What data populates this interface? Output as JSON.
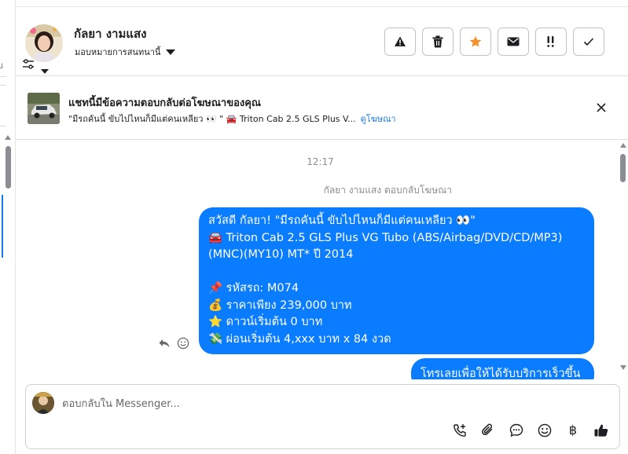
{
  "colors": {
    "accent": "#1877f2",
    "bubble": "#0a7cff",
    "star": "#f5922f",
    "border": "#bec3c9"
  },
  "header": {
    "name": "กัลยา งามแสง",
    "assign_label": "มอบหมายการสนทนานี้",
    "actions": [
      {
        "icon": "warning-icon",
        "glyph": "⚠"
      },
      {
        "icon": "trash-icon",
        "glyph": ""
      },
      {
        "icon": "star-icon",
        "glyph": "★"
      },
      {
        "icon": "mail-icon",
        "glyph": ""
      },
      {
        "icon": "follow-up-icon",
        "glyph": "!!"
      },
      {
        "icon": "checkmark-icon",
        "glyph": "✓"
      }
    ]
  },
  "left_strip": {
    "partial_char": "บ"
  },
  "banner": {
    "title": "แชทนี้มีข้อความตอบกลับต่อโฆษณาของคุณ",
    "subtitle": "\"มีรถคันนี้ ขับไปไหนก็มีแต่คนเหลียว 👀 \" 🚘 Triton Cab 2.5 GLS Plus V...",
    "link": "ดูโฆษณา"
  },
  "conversation": {
    "timestamp": "12:17",
    "reply_note": "กัลยา งามแสง ตอบกลับโฆษณา",
    "message_lines": [
      "สวัสดี กัลยา! \"มีรถคันนี้ ขับไปไหนก็มีแต่คนเหลียว 👀\"",
      "🚘 Triton Cab 2.5 GLS Plus VG Tubo (ABS/Airbag/DVD/CD/MP3)",
      "(MNC)(MY10) MT* ปี 2014",
      "",
      "📌 รหัสรถ: M074",
      "💰 ราคาเพียง 239,000 บาท",
      "⭐ ดาวน์เริ่มต้น 0 บาท",
      "💸 ผ่อนเริ่มต้น 4,xxx บาท x 84 งวด"
    ],
    "second_message": "โทรเลยเพื่อให้ได้รับบริการเร็วขึ้น"
  },
  "composer": {
    "placeholder": "ตอบกลับใน Messenger...",
    "tools": [
      {
        "icon": "call-add-icon",
        "glyph": "✆"
      },
      {
        "icon": "attachment-icon",
        "glyph": ""
      },
      {
        "icon": "chat-bubble-icon",
        "glyph": ""
      },
      {
        "icon": "emoji-icon",
        "glyph": "☺"
      },
      {
        "icon": "baht-icon",
        "glyph": "฿"
      },
      {
        "icon": "thumbs-up-icon",
        "glyph": ""
      }
    ]
  }
}
